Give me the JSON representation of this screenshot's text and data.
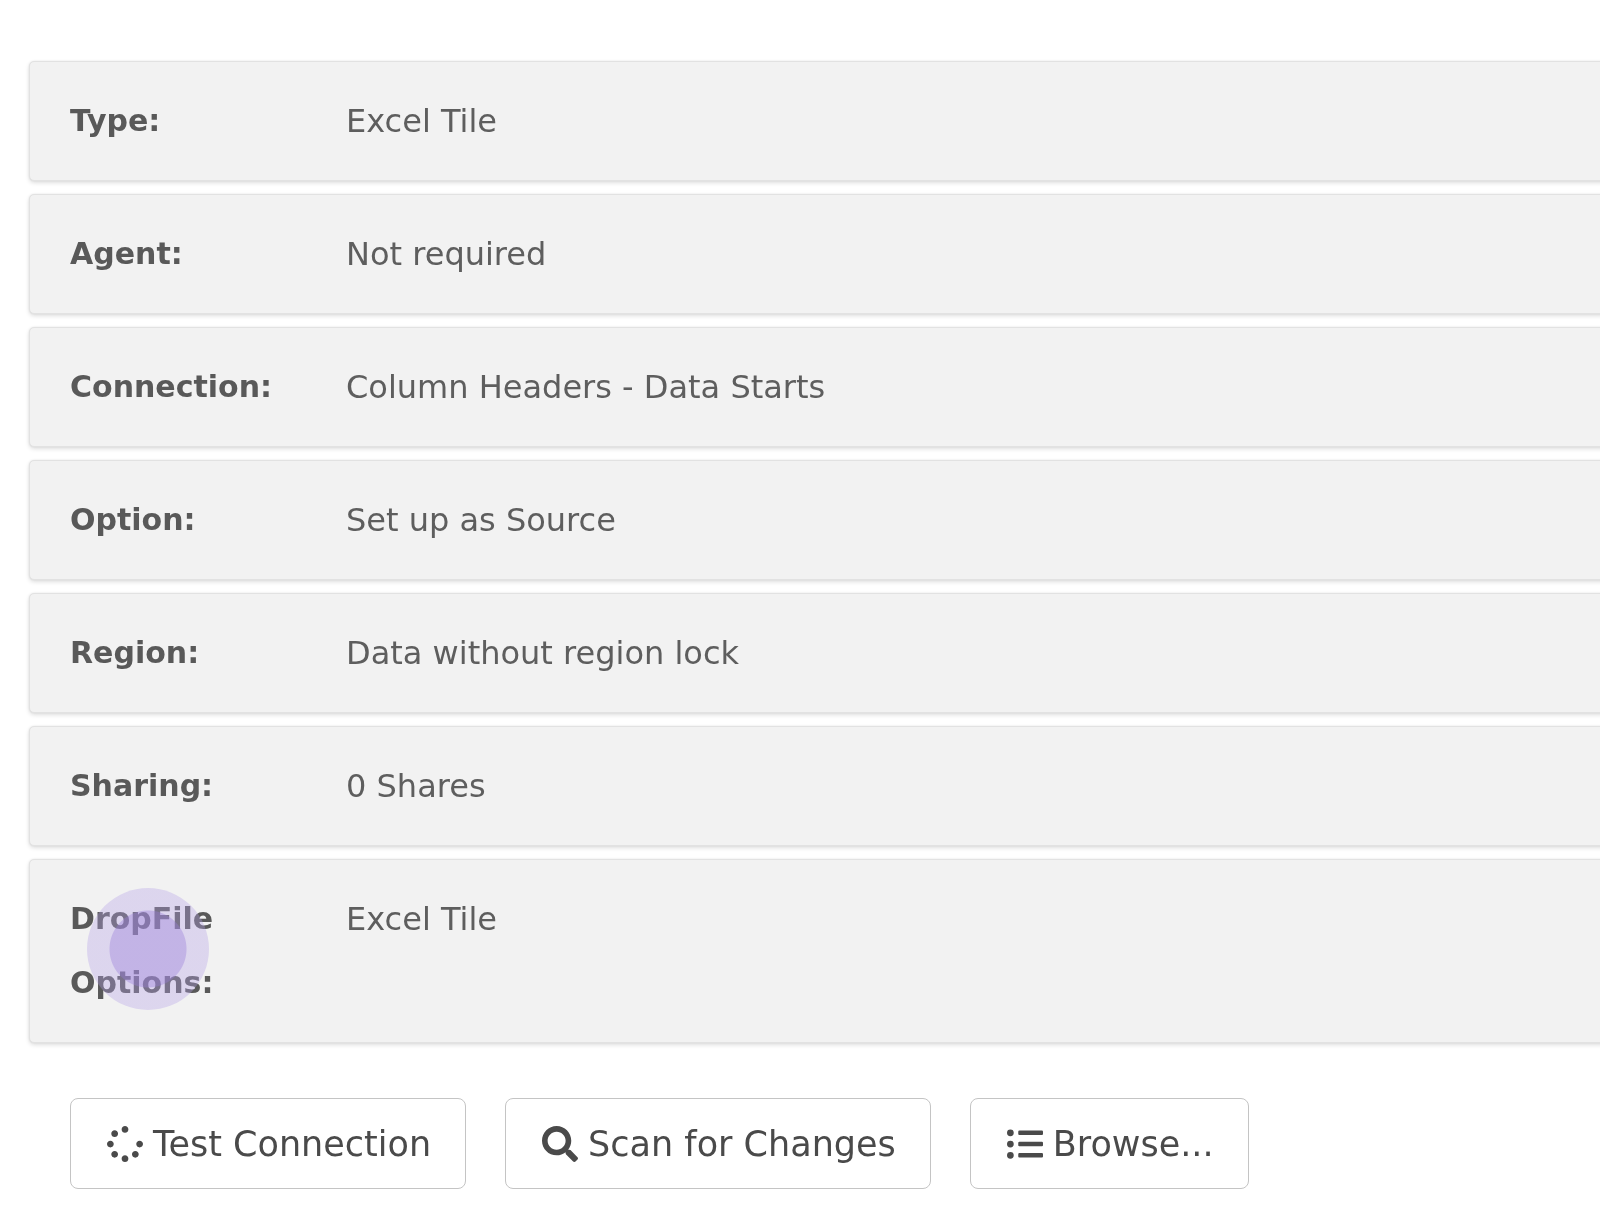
{
  "rows": [
    {
      "label": "Type:",
      "value": "Excel Tile",
      "clicked": false
    },
    {
      "label": "Agent:",
      "value": "Not required",
      "clicked": false
    },
    {
      "label": "Connection:",
      "value": "Column Headers - Data Starts",
      "clicked": false
    },
    {
      "label": "Option:",
      "value": "Set up as Source",
      "clicked": false
    },
    {
      "label": "Region:",
      "value": "Data without region lock",
      "clicked": false
    },
    {
      "label": "Sharing:",
      "value": "0 Shares",
      "clicked": false
    },
    {
      "label": "DropFile Options:",
      "value": "Excel Tile",
      "clicked": true
    }
  ],
  "buttons": [
    {
      "kind": "test",
      "label": "Test Connection"
    },
    {
      "kind": "scan",
      "label": "Scan for Changes"
    },
    {
      "kind": "browse",
      "label": "Browse..."
    }
  ]
}
